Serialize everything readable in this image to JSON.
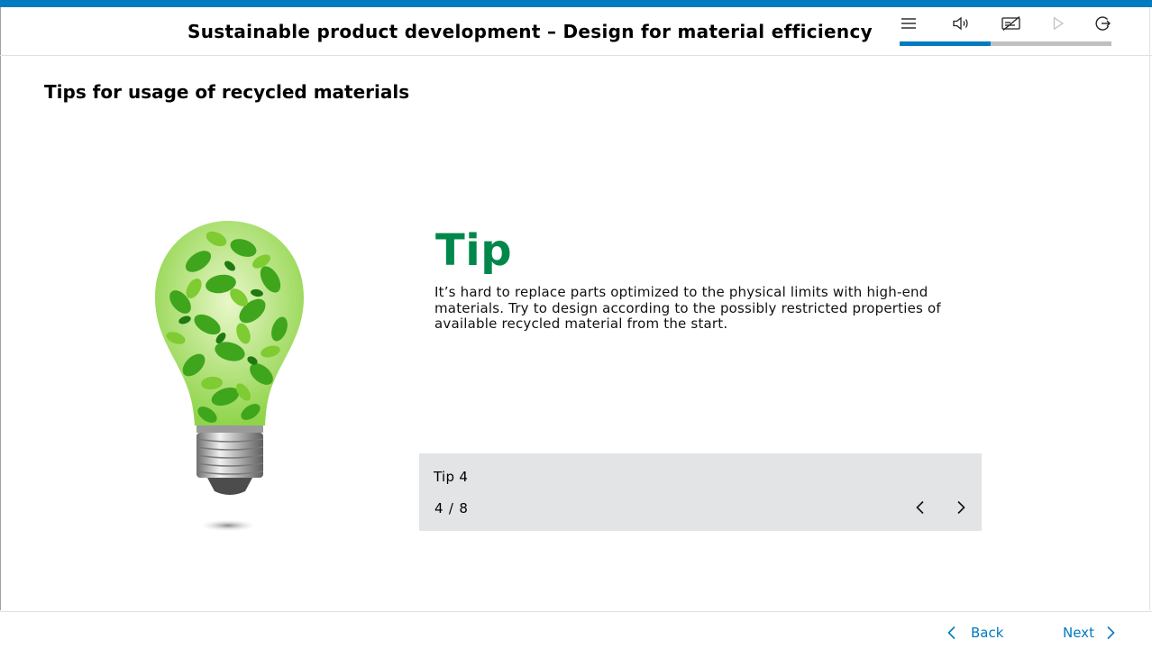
{
  "header": {
    "course_title": "Sustainable product development – Design for material efficiency",
    "toolbar": {
      "menu_icon": "menu-icon",
      "audio_icon": "speaker-icon",
      "subtitles_icon": "subtitles-off-icon",
      "play_icon": "play-icon",
      "exit_icon": "exit-icon"
    },
    "progress": 0.43
  },
  "page": {
    "title": "Tips for usage of recycled materials"
  },
  "tip": {
    "heading": "Tip",
    "text": "It’s hard to replace parts optimized to the physical limits with high-end materials. Try to design according to the possibly restricted properties of available recycled material from the start."
  },
  "carousel": {
    "label": "Tip 4",
    "counter": "4 / 8"
  },
  "footer": {
    "back_label": "Back",
    "next_label": "Next"
  },
  "colors": {
    "brand_blue": "#007bc0",
    "tip_green": "#00884a",
    "panel_gray": "#e3e4e6"
  }
}
